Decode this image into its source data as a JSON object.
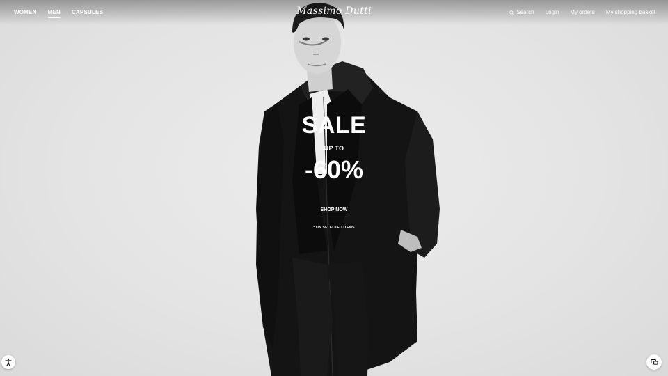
{
  "header": {
    "nav_left": [
      {
        "label": "WOMEN",
        "active": false
      },
      {
        "label": "MEN",
        "active": true
      },
      {
        "label": "CAPSULES",
        "active": false
      }
    ],
    "logo_text": "Massimo Dutti",
    "search_label": "Search",
    "login_label": "Login",
    "orders_label": "My orders",
    "basket_label": "My shopping basket"
  },
  "promo": {
    "title": "SALE",
    "up_to": "UP TO",
    "discount": "-60%",
    "cta": "SHOP NOW",
    "note": "* ON SELECTED ITEMS"
  },
  "icons": {
    "search": "search-icon",
    "accessibility": "accessibility-icon",
    "chat": "chat-icon"
  },
  "colors": {
    "background": "#e6e6e6",
    "text_overlay": "#ffffff",
    "coat": "#141414"
  }
}
